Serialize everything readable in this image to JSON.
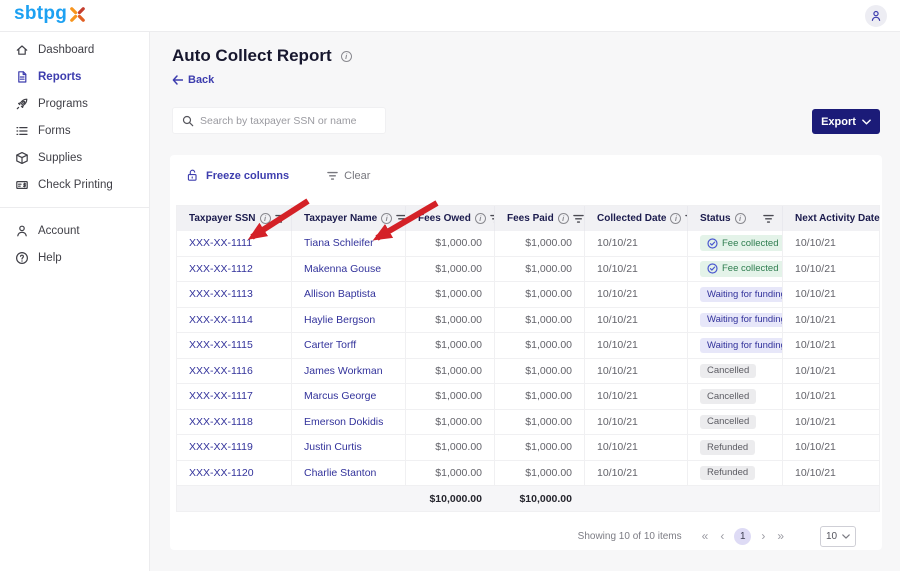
{
  "topbar": {
    "logo_text": "sbtpg"
  },
  "sidebar": {
    "items": [
      {
        "label": "Dashboard",
        "icon": "dashboard-home-icon",
        "active": false
      },
      {
        "label": "Reports",
        "icon": "reports-document-icon",
        "active": true
      },
      {
        "label": "Programs",
        "icon": "programs-rocket-icon",
        "active": false
      },
      {
        "label": "Forms",
        "icon": "forms-list-icon",
        "active": false
      },
      {
        "label": "Supplies",
        "icon": "supplies-box-icon",
        "active": false
      },
      {
        "label": "Check Printing",
        "icon": "check-printing-icon",
        "active": false
      }
    ],
    "footer_items": [
      {
        "label": "Account",
        "icon": "account-person-icon",
        "active": false
      },
      {
        "label": "Help",
        "icon": "help-question-icon",
        "active": false
      }
    ]
  },
  "header": {
    "title": "Auto Collect Report",
    "back_label": "Back"
  },
  "search": {
    "placeholder": "Search by taxpayer SSN or name"
  },
  "toolbar": {
    "export_label": "Export"
  },
  "table_controls": {
    "freeze_label": "Freeze columns",
    "clear_label": "Clear"
  },
  "table": {
    "columns": [
      {
        "label": "Taxpayer SSN",
        "info": true,
        "filter": true
      },
      {
        "label": "Taxpayer Name",
        "info": true,
        "filter": true
      },
      {
        "label": "Fees Owed",
        "info": true,
        "filter": true
      },
      {
        "label": "Fees Paid",
        "info": true,
        "filter": true
      },
      {
        "label": "Collected Date",
        "info": true,
        "filter": true
      },
      {
        "label": "Status",
        "info": true,
        "filter": true
      },
      {
        "label": "Next Activity Date",
        "info": true,
        "filter": false
      }
    ],
    "rows": [
      {
        "ssn": "XXX-XX-1111",
        "name": "Tiana Schleifer",
        "fees_owed": "$1,000.00",
        "fees_paid": "$1,000.00",
        "collected_date": "10/10/21",
        "status": "Fee collected",
        "status_type": "success",
        "next_activity_date": "10/10/21"
      },
      {
        "ssn": "XXX-XX-1112",
        "name": "Makenna Gouse",
        "fees_owed": "$1,000.00",
        "fees_paid": "$1,000.00",
        "collected_date": "10/10/21",
        "status": "Fee collected",
        "status_type": "success",
        "next_activity_date": "10/10/21"
      },
      {
        "ssn": "XXX-XX-1113",
        "name": "Allison Baptista",
        "fees_owed": "$1,000.00",
        "fees_paid": "$1,000.00",
        "collected_date": "10/10/21",
        "status": "Waiting for funding",
        "status_type": "waiting",
        "next_activity_date": "10/10/21"
      },
      {
        "ssn": "XXX-XX-1114",
        "name": "Haylie Bergson",
        "fees_owed": "$1,000.00",
        "fees_paid": "$1,000.00",
        "collected_date": "10/10/21",
        "status": "Waiting for funding",
        "status_type": "waiting",
        "next_activity_date": "10/10/21"
      },
      {
        "ssn": "XXX-XX-1115",
        "name": "Carter Torff",
        "fees_owed": "$1,000.00",
        "fees_paid": "$1,000.00",
        "collected_date": "10/10/21",
        "status": "Waiting for funding",
        "status_type": "waiting",
        "next_activity_date": "10/10/21"
      },
      {
        "ssn": "XXX-XX-1116",
        "name": "James Workman",
        "fees_owed": "$1,000.00",
        "fees_paid": "$1,000.00",
        "collected_date": "10/10/21",
        "status": "Cancelled",
        "status_type": "neutral",
        "next_activity_date": "10/10/21"
      },
      {
        "ssn": "XXX-XX-1117",
        "name": "Marcus George",
        "fees_owed": "$1,000.00",
        "fees_paid": "$1,000.00",
        "collected_date": "10/10/21",
        "status": "Cancelled",
        "status_type": "neutral",
        "next_activity_date": "10/10/21"
      },
      {
        "ssn": "XXX-XX-1118",
        "name": "Emerson Dokidis",
        "fees_owed": "$1,000.00",
        "fees_paid": "$1,000.00",
        "collected_date": "10/10/21",
        "status": "Cancelled",
        "status_type": "neutral",
        "next_activity_date": "10/10/21"
      },
      {
        "ssn": "XXX-XX-1119",
        "name": "Justin Curtis",
        "fees_owed": "$1,000.00",
        "fees_paid": "$1,000.00",
        "collected_date": "10/10/21",
        "status": "Refunded",
        "status_type": "neutral",
        "next_activity_date": "10/10/21"
      },
      {
        "ssn": "XXX-XX-1120",
        "name": "Charlie Stanton",
        "fees_owed": "$1,000.00",
        "fees_paid": "$1,000.00",
        "collected_date": "10/10/21",
        "status": "Refunded",
        "status_type": "neutral",
        "next_activity_date": "10/10/21"
      }
    ],
    "totals": {
      "fees_owed": "$10,000.00",
      "fees_paid": "$10,000.00"
    }
  },
  "pagination": {
    "summary": "Showing 10 of 10 items",
    "first": "«",
    "prev": "‹",
    "current_page": "1",
    "next": "›",
    "last": "»",
    "page_size": "10"
  },
  "colors": {
    "accent": "#3d3dae",
    "logo_blue": "#1da1f2",
    "logo_orange": "#f7941d",
    "logo_red": "#c43d2e",
    "export_bg": "#1b1b78",
    "arrow_red": "#d42127",
    "header_text": "#1b1b4d",
    "link_text": "#32329b",
    "status_success_bg": "#e4f3e9",
    "status_success_text": "#2e7d4f",
    "status_waiting_bg": "#e7e7f9",
    "status_waiting_text": "#32329b",
    "status_neutral_bg": "#ececee",
    "status_neutral_text": "#5c5c63"
  }
}
